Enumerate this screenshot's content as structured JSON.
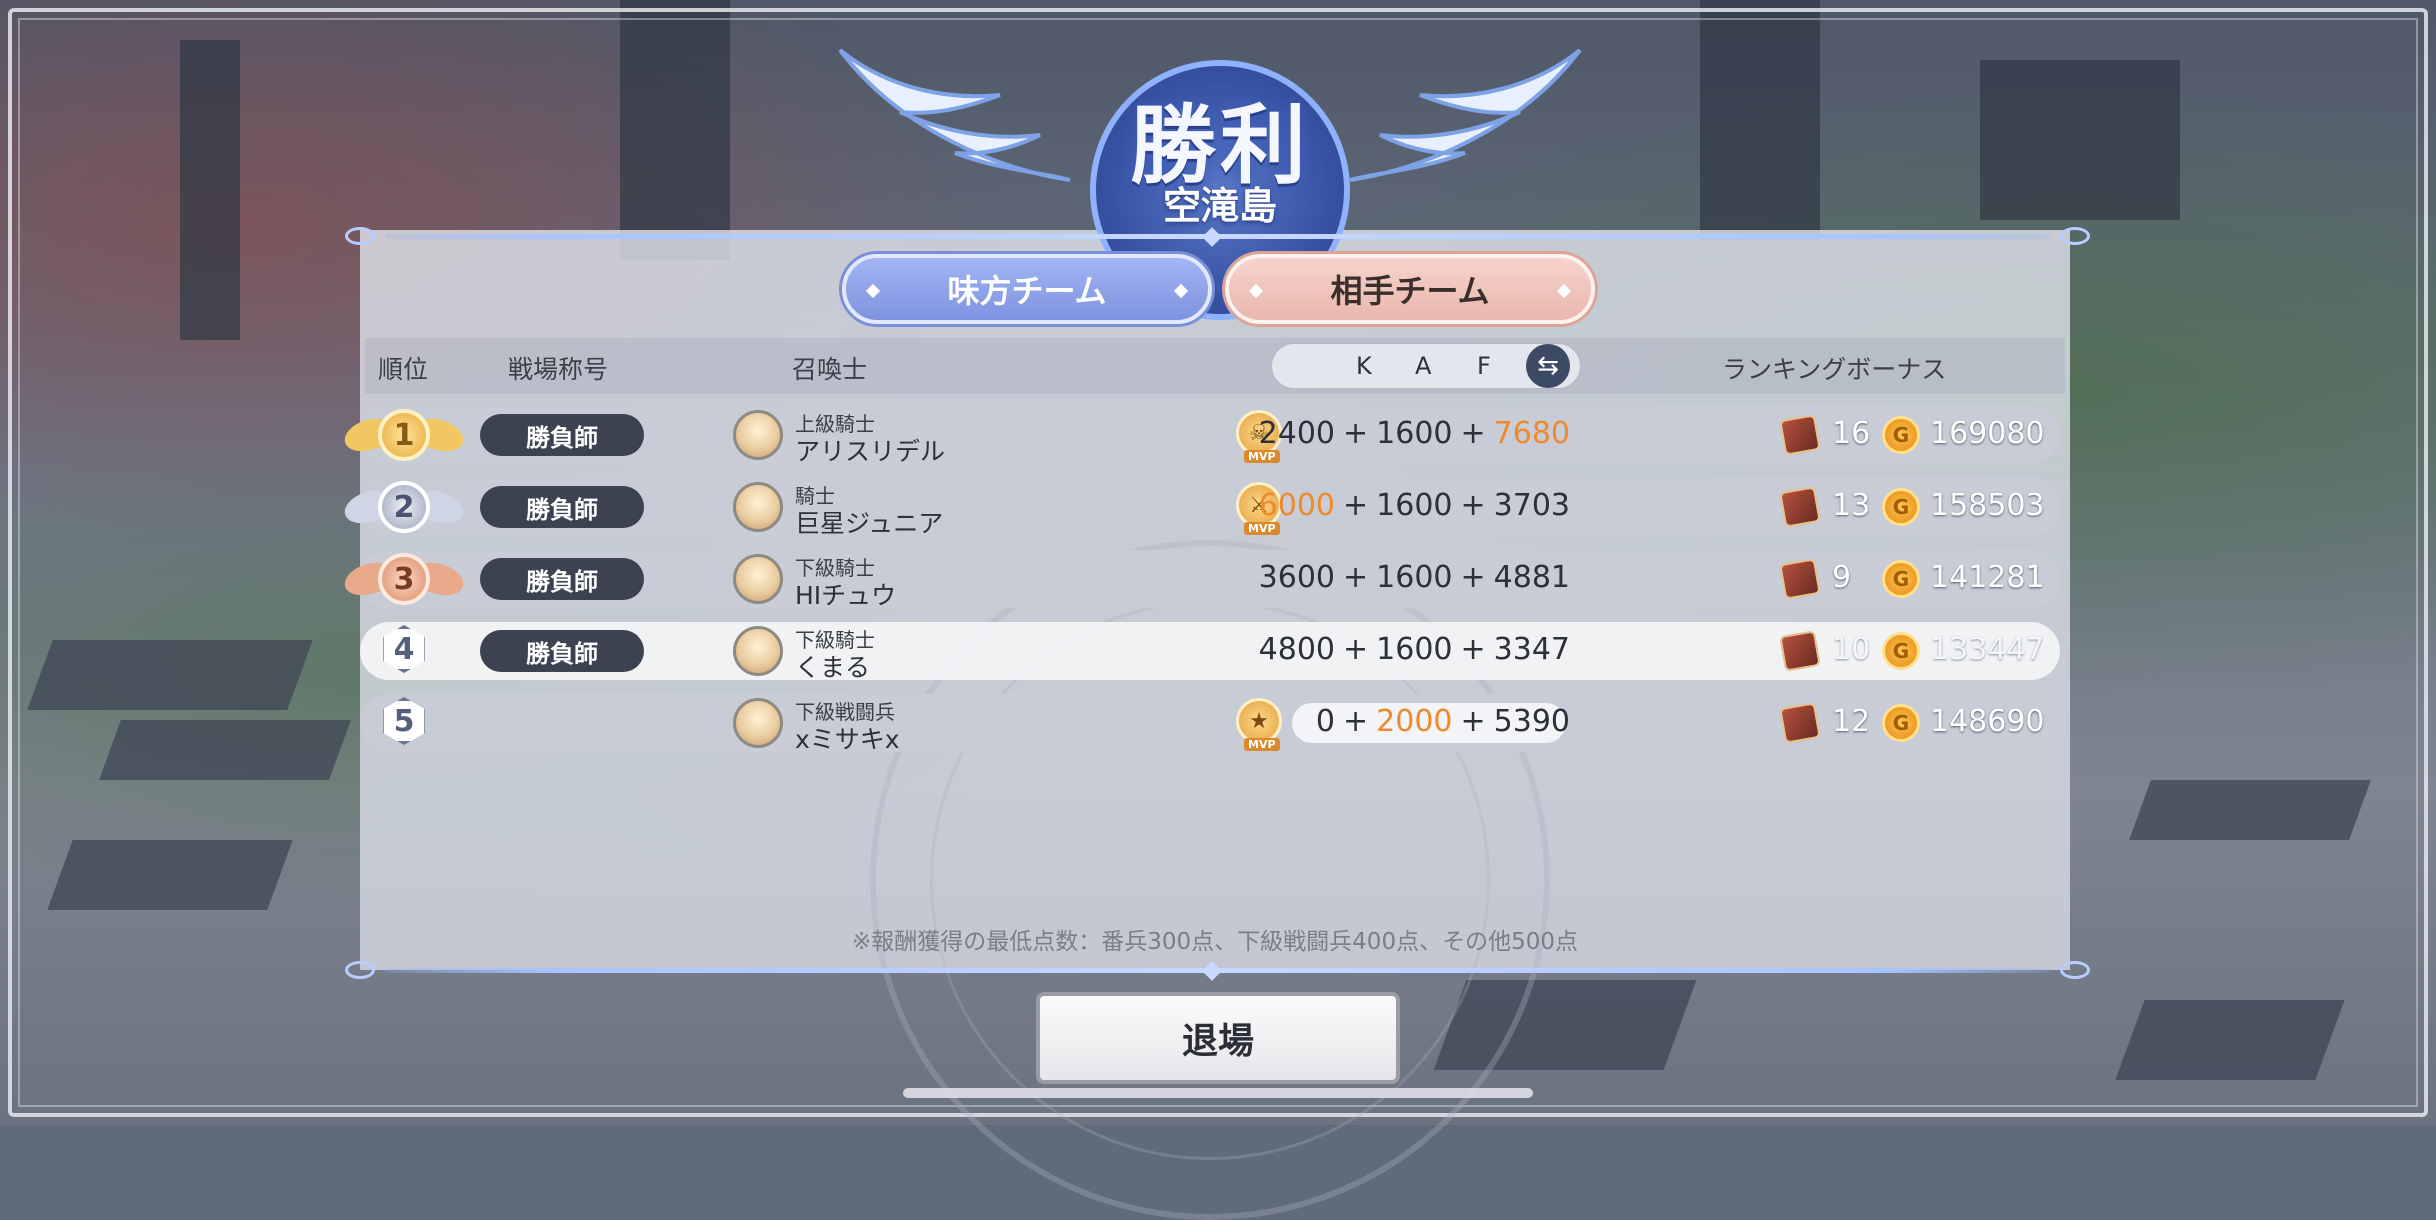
{
  "header": {
    "title": "勝利",
    "subtitle": "空滝島"
  },
  "tabs": [
    {
      "label": "味方チーム",
      "active": false
    },
    {
      "label": "相手チーム",
      "active": true
    }
  ],
  "columns": {
    "rank": "順位",
    "battle_title": "戦場称号",
    "summoner": "召喚士",
    "kaf": [
      "K",
      "A",
      "F"
    ],
    "bonus": "ランキングボーナス"
  },
  "rows": [
    {
      "rank": "1",
      "title": "勝負師",
      "summoner_rank": "上級騎士",
      "name": "アリスリデル",
      "mvp": true,
      "mvp_icon": "skull-icon",
      "k": "2400",
      "a": "1600",
      "f": "7680",
      "orange": "f",
      "chests": "16",
      "gold": "169080"
    },
    {
      "rank": "2",
      "title": "勝負師",
      "summoner_rank": "騎士",
      "name": "巨星ジュニア",
      "mvp": true,
      "mvp_icon": "sword-icon",
      "k": "6000",
      "a": "1600",
      "f": "3703",
      "orange": "k",
      "chests": "13",
      "gold": "158503"
    },
    {
      "rank": "3",
      "title": "勝負師",
      "summoner_rank": "下級騎士",
      "name": "HIチュウ",
      "mvp": false,
      "k": "3600",
      "a": "1600",
      "f": "4881",
      "orange": "",
      "chests": "9",
      "gold": "141281"
    },
    {
      "rank": "4",
      "title": "勝負師",
      "summoner_rank": "下級騎士",
      "name": "くまる",
      "mvp": false,
      "k": "4800",
      "a": "1600",
      "f": "3347",
      "orange": "",
      "chests": "10",
      "gold": "133447"
    },
    {
      "rank": "5",
      "title": "",
      "summoner_rank": "下級戦闘兵",
      "name": "xミサキx",
      "mvp": true,
      "mvp_icon": "star-icon",
      "k": "0",
      "a": "2000",
      "f": "5390",
      "orange": "a",
      "chests": "12",
      "gold": "148690"
    }
  ],
  "mvp_label": "MVP",
  "plus": "+",
  "coin_letter": "G",
  "note": "※報酬獲得の最低点数：番兵300点、下級戦闘兵400点、その他500点",
  "exit_label": "退場",
  "colors": {
    "accent_orange": "#ee8a2c",
    "ally_tab": "#8a9ee6",
    "enemy_tab": "#efc4bb",
    "title_pill": "#3c4250"
  }
}
